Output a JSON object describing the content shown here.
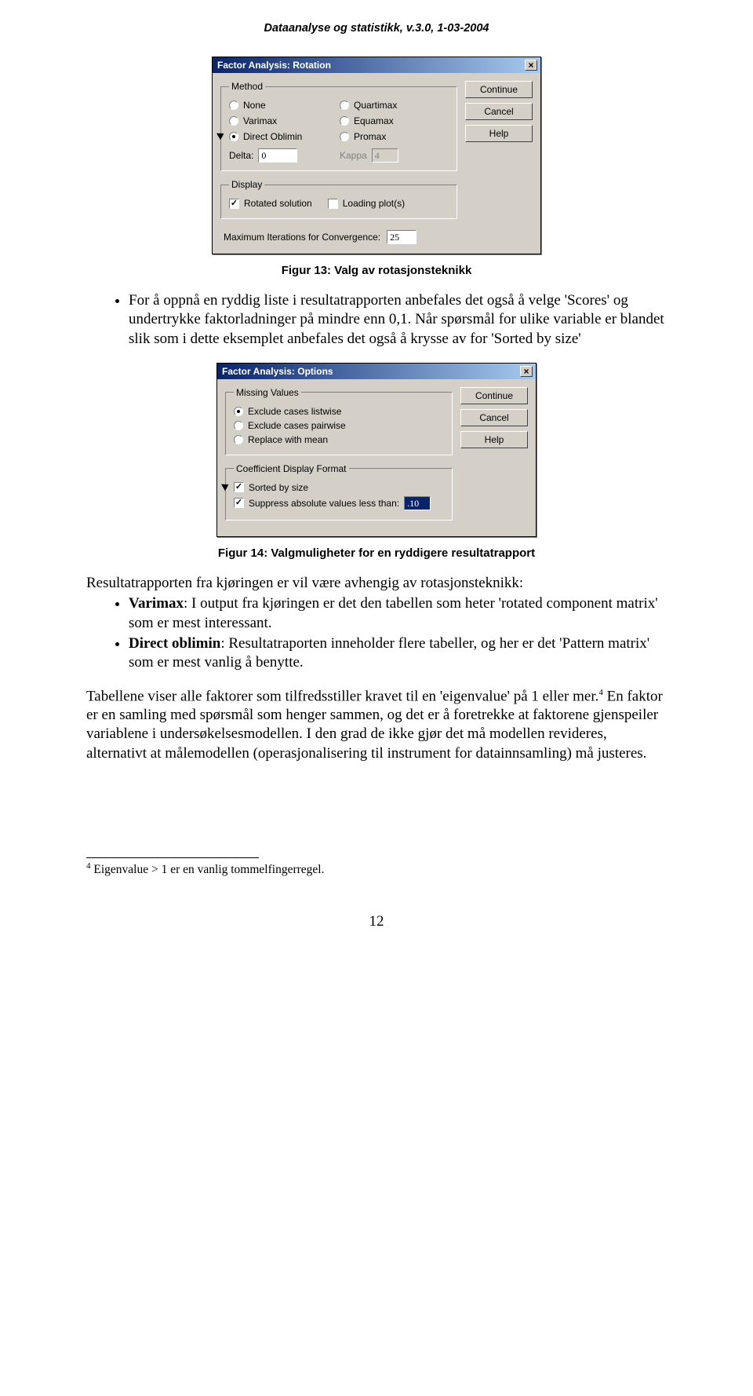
{
  "header": "Dataanalyse og statistikk, v.3.0, 1-03-2004",
  "dialog1": {
    "title": "Factor Analysis: Rotation",
    "group_method": "Method",
    "m_none": "None",
    "m_varimax": "Varimax",
    "m_oblimin": "Direct Oblimin",
    "m_quartimax": "Quartimax",
    "m_equamax": "Equamax",
    "m_promax": "Promax",
    "delta_label": "Delta:",
    "delta_val": "0",
    "kappa_label": "Kappa",
    "kappa_val": "4",
    "group_display": "Display",
    "rotated": "Rotated solution",
    "loading": "Loading plot(s)",
    "maxiter_label": "Maximum Iterations for Convergence:",
    "maxiter_val": "25",
    "btn_continue": "Continue",
    "btn_cancel": "Cancel",
    "btn_help": "Help"
  },
  "dialog2": {
    "title": "Factor Analysis: Options",
    "group_missing": "Missing Values",
    "mv_listwise": "Exclude cases listwise",
    "mv_pairwise": "Exclude cases pairwise",
    "mv_replace": "Replace with mean",
    "group_coef": "Coefficient Display Format",
    "sorted": "Sorted by size",
    "suppress": "Suppress absolute values less than:",
    "suppress_val": ".10",
    "btn_continue": "Continue",
    "btn_cancel": "Cancel",
    "btn_help": "Help"
  },
  "caption1": "Figur 13: Valg av rotasjonsteknikk",
  "bullets1": {
    "a": "For å oppnå en ryddig liste i resultatrapporten anbefales det også å velge 'Scores' og undertrykke faktorladninger på mindre enn 0,1. Når spørsmål for ulike variable er blandet slik som i dette eksemplet anbefales det også å krysse av for 'Sorted by size'"
  },
  "caption2": "Figur 14: Valgmuligheter for en ryddigere resultatrapport",
  "para2_intro": "Resultatrapporten fra kjøringen er vil være avhengig av rotasjonsteknikk:",
  "bullets2": {
    "a_label": "Varimax",
    "a_rest": ": I output fra kjøringen er det den tabellen som heter 'rotated component matrix' som er mest interessant.",
    "b_label": "Direct oblimin",
    "b_rest": ": Resultatraporten inneholder flere tabeller, og her er det 'Pattern matrix' som er mest vanlig å benytte."
  },
  "para3": "Tabellene viser alle faktorer som tilfredsstiller kravet til en 'eigenvalue' på 1 eller mer.",
  "para3_sup": "4",
  "para3_rest": " En faktor er en samling med spørsmål som henger sammen, og det er å foretrekke at faktorene gjenspeiler variablene i undersøkelsesmodellen. I den grad de ikke gjør det må modellen revideres, alternativt at målemodellen (operasjonalisering til instrument for datainnsamling) må justeres.",
  "footnote_sup": "4",
  "footnote": " Eigenvalue > 1 er en vanlig tommelfingerregel.",
  "page_num": "12"
}
